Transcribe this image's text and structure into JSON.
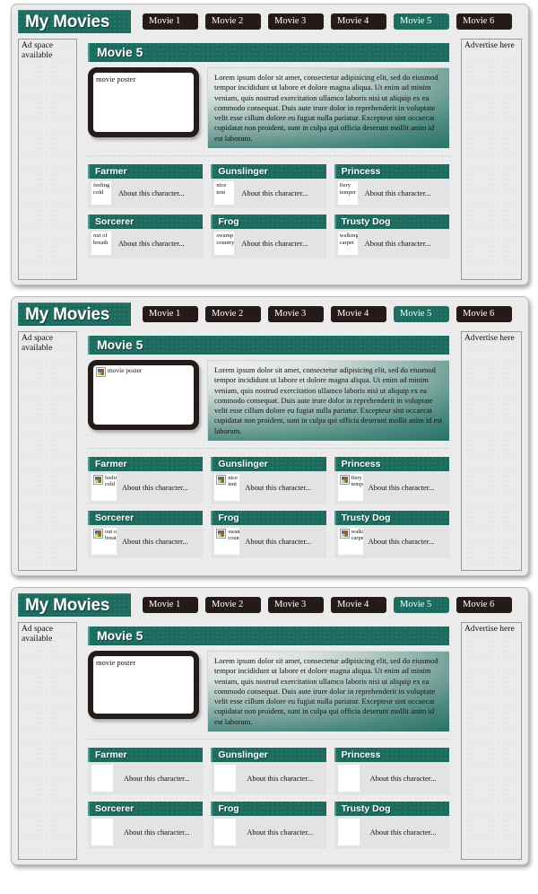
{
  "brand": {
    "title": "My Movies"
  },
  "tabs": [
    {
      "label": "Movie 1",
      "active": false
    },
    {
      "label": "Movie 2",
      "active": false
    },
    {
      "label": "Movie 3",
      "active": false
    },
    {
      "label": "Movie 4",
      "active": false
    },
    {
      "label": "Movie 5",
      "active": true
    },
    {
      "label": "Movie 6",
      "active": false
    }
  ],
  "aside_left": {
    "text": "Ad space available"
  },
  "aside_right": {
    "text": "Advertise here"
  },
  "movie": {
    "heading": "Movie 5",
    "poster_alt": "movie poster",
    "description": "Lorem ipsum dolor sit amet, consectetur adipisicing elit, sed do eiusmod tempor incididunt ut labore et dolore magna aliqua. Ut enim ad minim veniam, quis nostrud exercitation ullamco laboris nisi ut aliquip ex ea commodo consequat. Duis aute irure dolor in reprehenderit in voluptate velit esse cillum dolore eu fugiat nulla pariatur. Excepteur sint occaecat cupidatat non proident, sunt in culpa qui officia deserunt mollit anim id est laborum."
  },
  "characters": [
    {
      "name": "Farmer",
      "thumb_alt": "feeling cold",
      "about": "About this character..."
    },
    {
      "name": "Gunslinger",
      "thumb_alt": "nice tent",
      "about": "About this character..."
    },
    {
      "name": "Princess",
      "thumb_alt": "fiery temper",
      "about": "About this character..."
    },
    {
      "name": "Sorcerer",
      "thumb_alt": "out of breath",
      "about": "About this character..."
    },
    {
      "name": "Frog",
      "thumb_alt": "swamp country",
      "about": "About this character..."
    },
    {
      "name": "Trusty Dog",
      "thumb_alt": "walking carpet",
      "about": "About this character..."
    }
  ],
  "variants": [
    {
      "id": "alt-text",
      "images": "alt-text-shown"
    },
    {
      "id": "broken-icon",
      "images": "broken-image-icon-with-alt-text"
    },
    {
      "id": "blank",
      "images": "blank-placeholder"
    }
  ],
  "colors": {
    "accent_teal": "#1d6b5e",
    "tab_dark": "#231a18",
    "panel_bg": "#ebebeb",
    "content_bg": "#ececec",
    "card_body_bg": "#e3e3e3",
    "poster_border": "#241c19"
  }
}
